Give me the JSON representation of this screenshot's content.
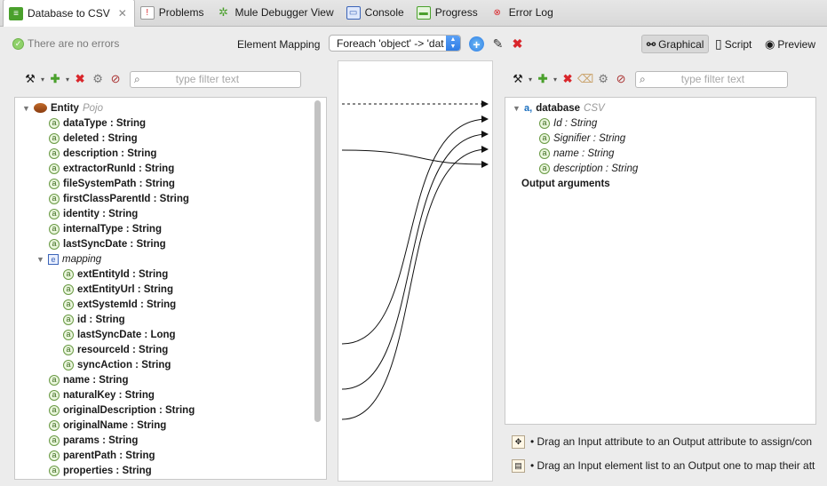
{
  "tabs": [
    {
      "label": "Database to CSV",
      "icon": "dataweave-icon",
      "active": true
    },
    {
      "label": "Problems",
      "icon": "problems-icon"
    },
    {
      "label": "Mule Debugger View",
      "icon": "debugger-icon"
    },
    {
      "label": "Console",
      "icon": "console-icon"
    },
    {
      "label": "Progress",
      "icon": "progress-icon"
    },
    {
      "label": "Error Log",
      "icon": "error-log-icon"
    }
  ],
  "toolbar": {
    "status": "There are no errors",
    "element_mapping_label": "Element Mapping",
    "element_mapping_value": "Foreach 'object' -> 'dat",
    "views": [
      {
        "label": "Graphical",
        "selected": true
      },
      {
        "label": "Script",
        "selected": false
      },
      {
        "label": "Preview",
        "selected": false
      }
    ]
  },
  "left": {
    "filter_placeholder": "type filter text",
    "root": {
      "name": "Entity",
      "type": "Pojo"
    },
    "fields": [
      "dataType : String",
      "deleted : String",
      "description : String",
      "extractorRunId : String",
      "fileSystemPath : String",
      "firstClassParentId : String",
      "identity : String",
      "internalType : String",
      "lastSyncDate : String"
    ],
    "mapping": {
      "name": "mapping",
      "fields": [
        "extEntityId : String",
        "extEntityUrl : String",
        "extSystemId : String",
        "id : String",
        "lastSyncDate : Long",
        "resourceId : String",
        "syncAction : String"
      ]
    },
    "fields_after": [
      "name : String",
      "naturalKey : String",
      "originalDescription : String",
      "originalName : String",
      "params : String",
      "parentPath : String",
      "properties : String"
    ]
  },
  "right": {
    "filter_placeholder": "type filter text",
    "root": {
      "name": "database",
      "type": "CSV"
    },
    "fields": [
      "Id : String",
      "Signifier : String",
      "name : String",
      "description : String"
    ],
    "output_arguments": "Output arguments",
    "hints": [
      "• Drag an Input attribute to an Output attribute to assign/con",
      "• Drag an Input element list to an Output one to map their att"
    ]
  },
  "colors": {
    "accent": "#2f7ce5",
    "ok": "#8fd16a",
    "delete": "#d9262b",
    "add": "#4aa02c"
  }
}
